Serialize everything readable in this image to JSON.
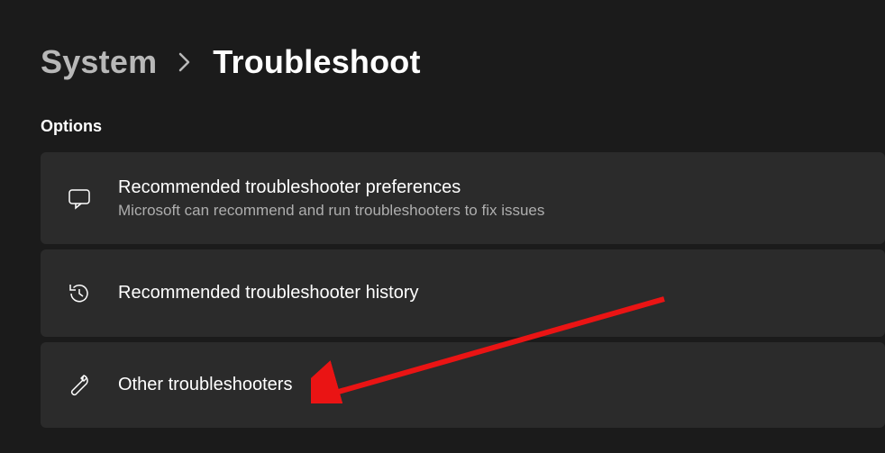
{
  "breadcrumb": {
    "parent": "System",
    "current": "Troubleshoot"
  },
  "section": {
    "title": "Options"
  },
  "cards": {
    "preferences": {
      "title": "Recommended troubleshooter preferences",
      "subtitle": "Microsoft can recommend and run troubleshooters to fix issues"
    },
    "history": {
      "title": "Recommended troubleshooter history"
    },
    "other": {
      "title": "Other troubleshooters"
    }
  }
}
